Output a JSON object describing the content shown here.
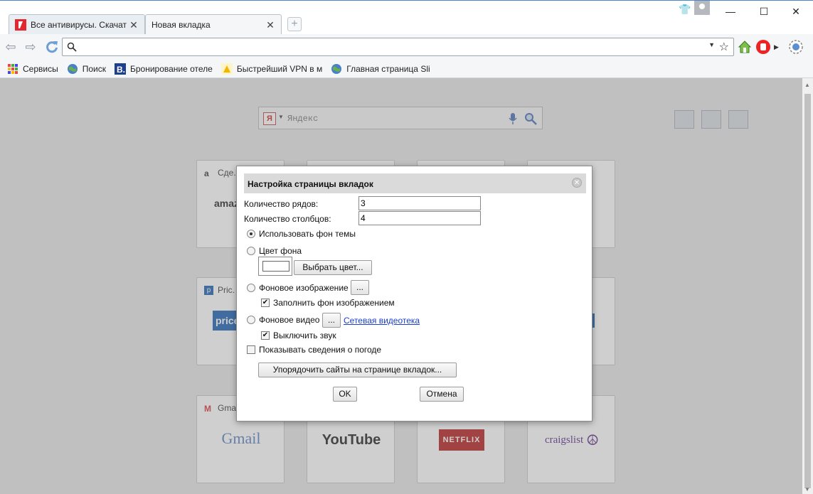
{
  "tabs": [
    {
      "title": "Все антивирусы. Скачат",
      "active": false
    },
    {
      "title": "Новая вкладка",
      "active": true
    }
  ],
  "toolbar": {
    "address_value": ""
  },
  "bookmarks": [
    {
      "label": "Сервисы",
      "icon": "apps-grid-icon"
    },
    {
      "label": "Поиск",
      "icon": "globe-icon"
    },
    {
      "label": "Бронирование отеле",
      "icon": "booking-icon"
    },
    {
      "label": "Быстрейший VPN в м",
      "icon": "vpn-icon"
    },
    {
      "label": "Главная страница Sli",
      "icon": "globe-icon"
    }
  ],
  "search": {
    "logo": "Я",
    "placeholder": "Яндекс"
  },
  "tiles": [
    {
      "name": "Сде.",
      "logo": "amaz"
    },
    {
      "name": "Pric.",
      "logo": "price"
    },
    {
      "name": "Gma",
      "logo": "Gmail"
    },
    {
      "name": "",
      "logo": "YouTube"
    },
    {
      "name": "",
      "logo": "NETFLIX"
    },
    {
      "name": "",
      "logo": "craigslist"
    }
  ],
  "dialog": {
    "title": "Настройка страницы вкладок",
    "rows_label": "Количество рядов:",
    "rows_value": "3",
    "cols_label": "Количество столбцов:",
    "cols_value": "4",
    "use_theme_bg": "Использовать фон темы",
    "bg_color": "Цвет фона",
    "choose_color": "Выбрать цвет...",
    "bg_image": "Фоновое изображение",
    "browse": "...",
    "fill_bg_image": "Заполнить фон изображением",
    "bg_video": "Фоновое видео",
    "video_library": "Сетевая видеотека",
    "mute": "Выключить звук",
    "show_weather": "Показывать сведения о погоде",
    "arrange_sites": "Упорядочить сайты на странице вкладок...",
    "ok": "OK",
    "cancel": "Отмена"
  }
}
